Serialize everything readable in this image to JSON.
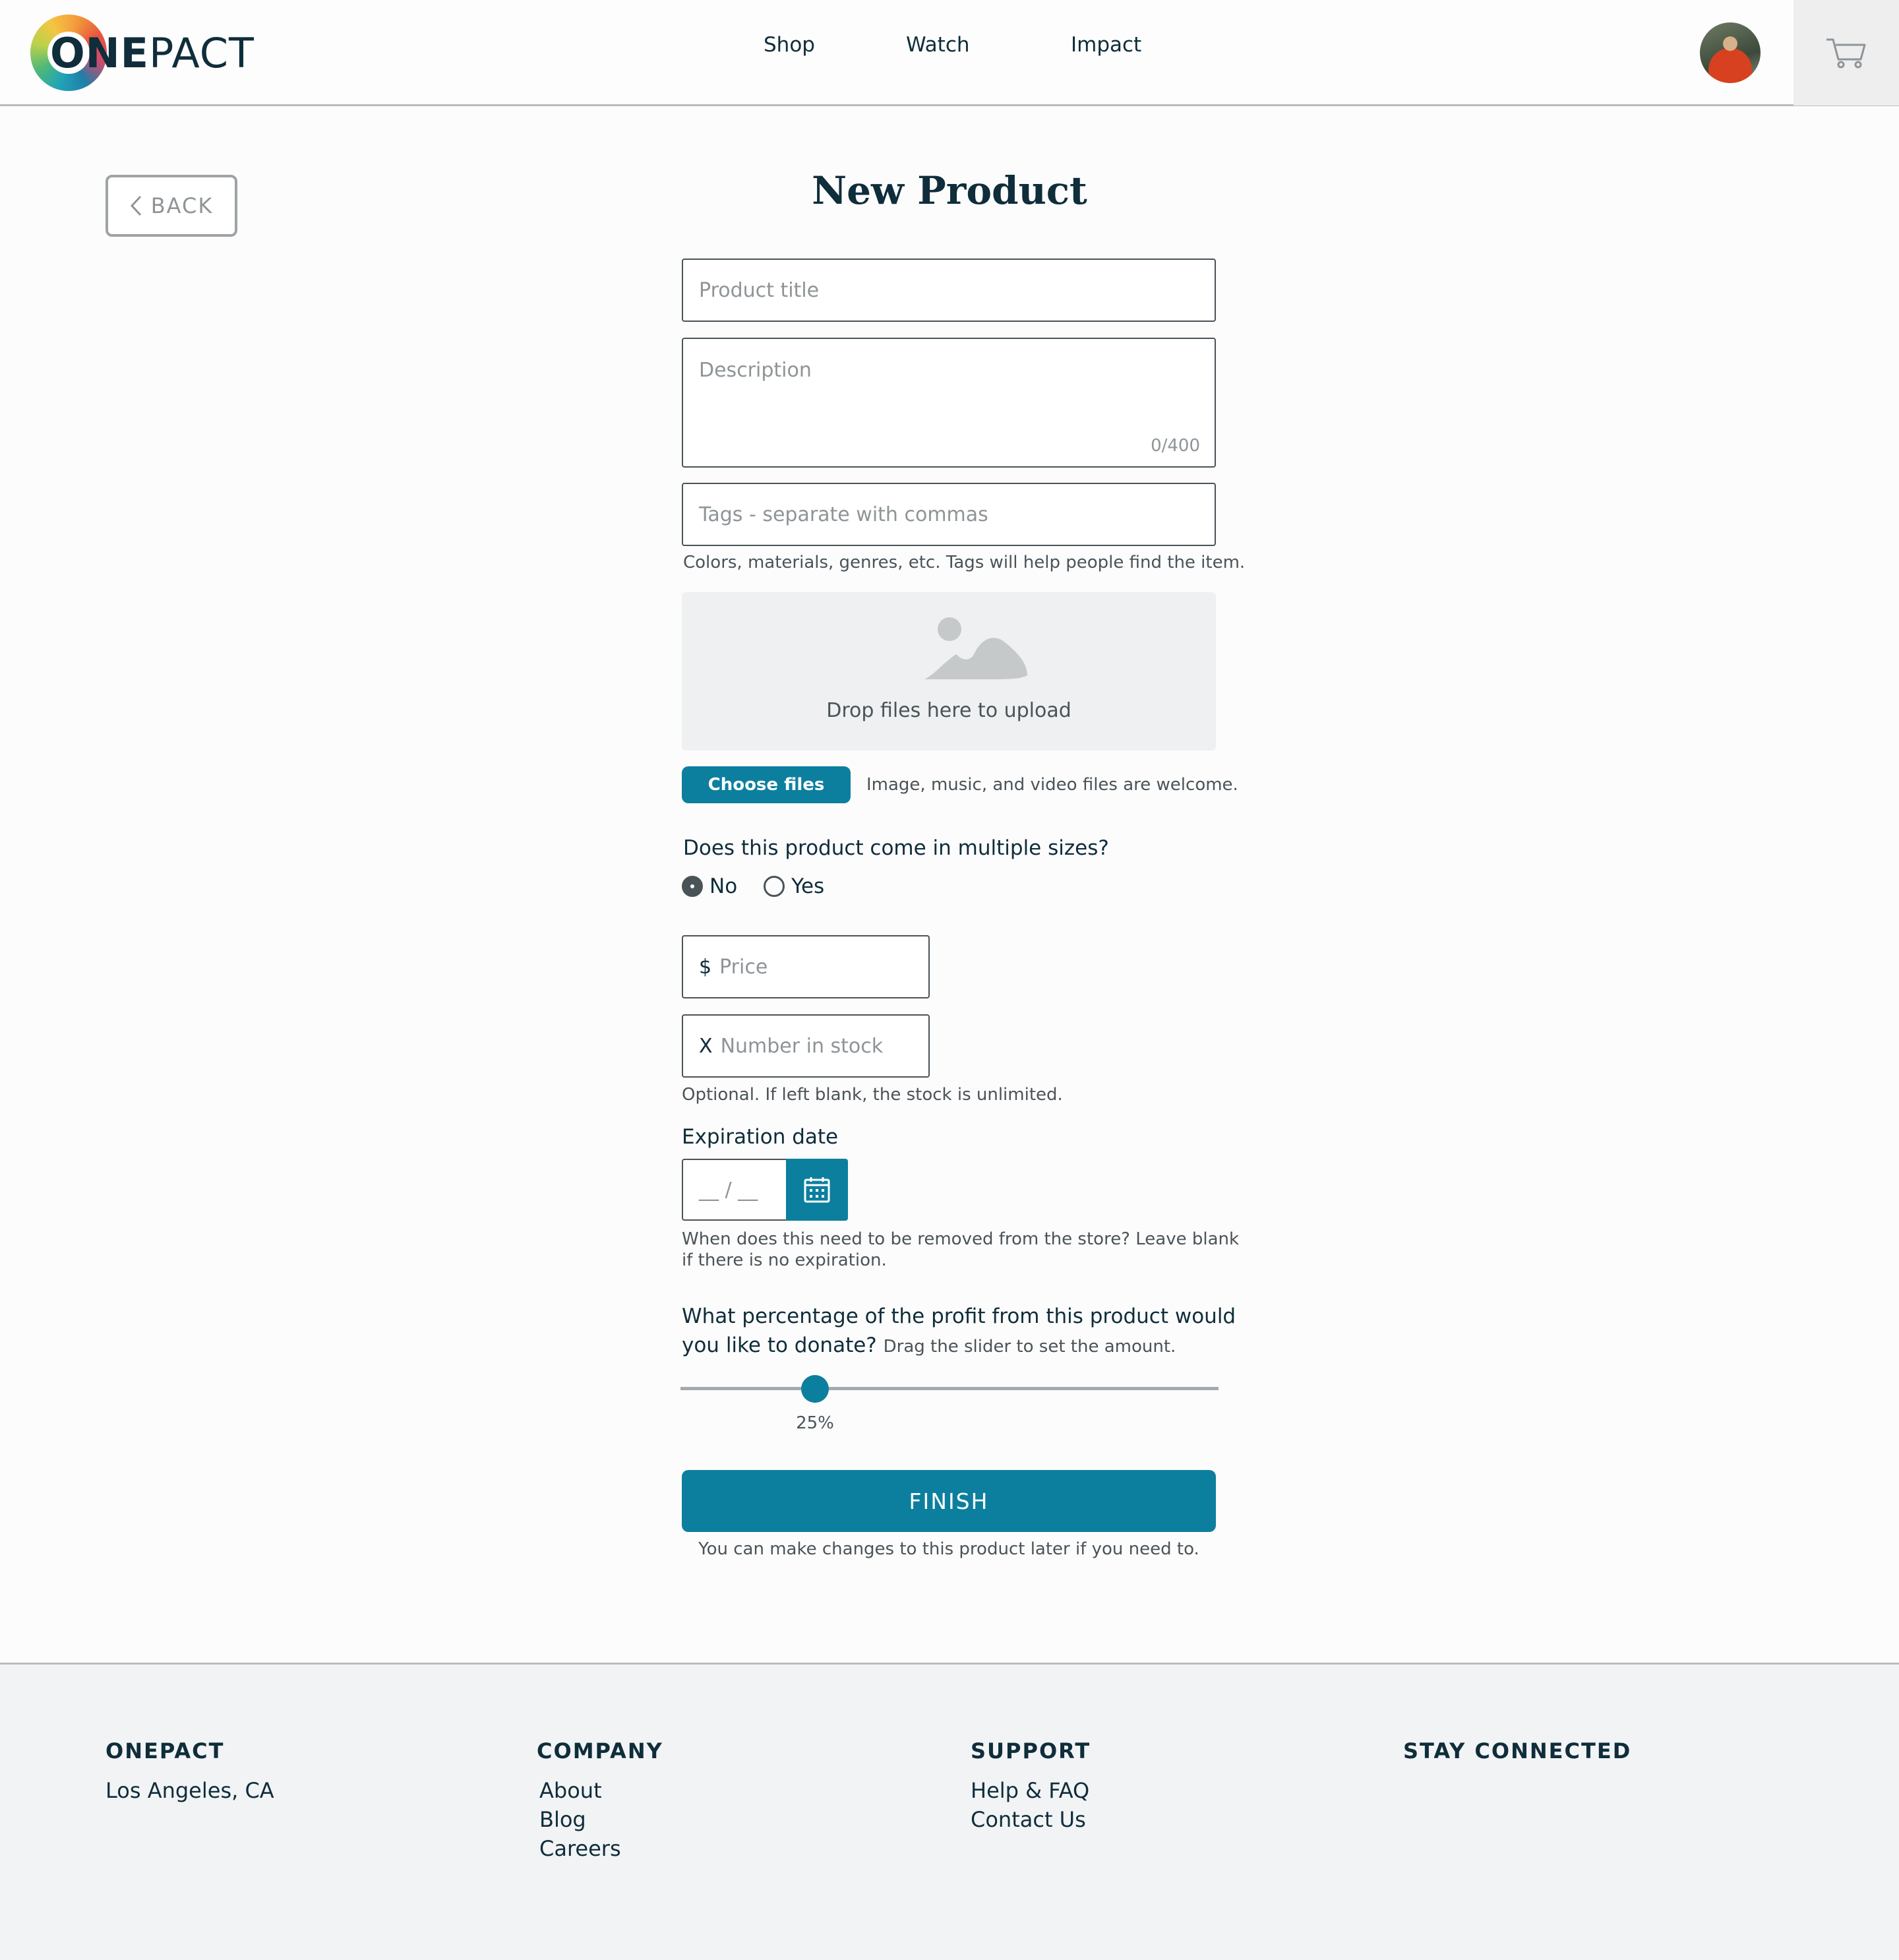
{
  "header": {
    "logo": {
      "brand_bold": "ONE",
      "brand_light": "PACT"
    },
    "nav": [
      {
        "label": "Shop"
      },
      {
        "label": "Watch"
      },
      {
        "label": "Impact"
      }
    ]
  },
  "back_label": "BACK",
  "form": {
    "title": "New Product",
    "product_title_placeholder": "Product title",
    "description_placeholder": "Description",
    "description_counter": "0/400",
    "tags_placeholder": "Tags - separate with commas",
    "tags_hint": "Colors, materials, genres, etc. Tags will help people find the item.",
    "dropzone_text": "Drop files here to upload",
    "choose_files_label": "Choose files",
    "files_hint": "Image, music, and video files are welcome.",
    "sizes_question": "Does this product come in multiple sizes?",
    "sizes_options": [
      {
        "label": "No",
        "checked": true
      },
      {
        "label": "Yes",
        "checked": false
      }
    ],
    "price_prefix": "$",
    "price_placeholder": "Price",
    "stock_prefix": "X",
    "stock_placeholder": "Number in stock",
    "stock_hint": "Optional. If left blank, the stock is unlimited.",
    "expiration_label": "Expiration date",
    "expiration_placeholder": "__ / __",
    "expiration_hint_line1": "When does this need to be removed from the store? Leave blank",
    "expiration_hint_line2": "if there is no expiration.",
    "donate_question_line1": "What percentage of the profit from this product would",
    "donate_question_line2": "you like to donate?",
    "donate_hint": "Drag the slider to set the amount.",
    "donate_percent": 25,
    "donate_value_label": "25%",
    "finish_label": "FINISH",
    "finish_hint": "You can make changes to this product later if you need to."
  },
  "footer": {
    "columns": [
      {
        "heading": "ONEPACT",
        "items": [
          "Los Angeles, CA"
        ]
      },
      {
        "heading": "COMPANY",
        "items": [
          "About",
          "Blog",
          "Careers"
        ]
      },
      {
        "heading": "SUPPORT",
        "items": [
          "Help & FAQ",
          "Contact Us"
        ]
      },
      {
        "heading": "STAY CONNECTED",
        "items": []
      }
    ]
  },
  "colors": {
    "accent": "#0d7f9e",
    "text": "#0f2d3a",
    "muted": "#8e9497",
    "footer_bg": "#f2f3f5"
  },
  "icons": [
    "chevron-left-icon",
    "cart-icon",
    "image-placeholder-icon",
    "calendar-icon"
  ]
}
